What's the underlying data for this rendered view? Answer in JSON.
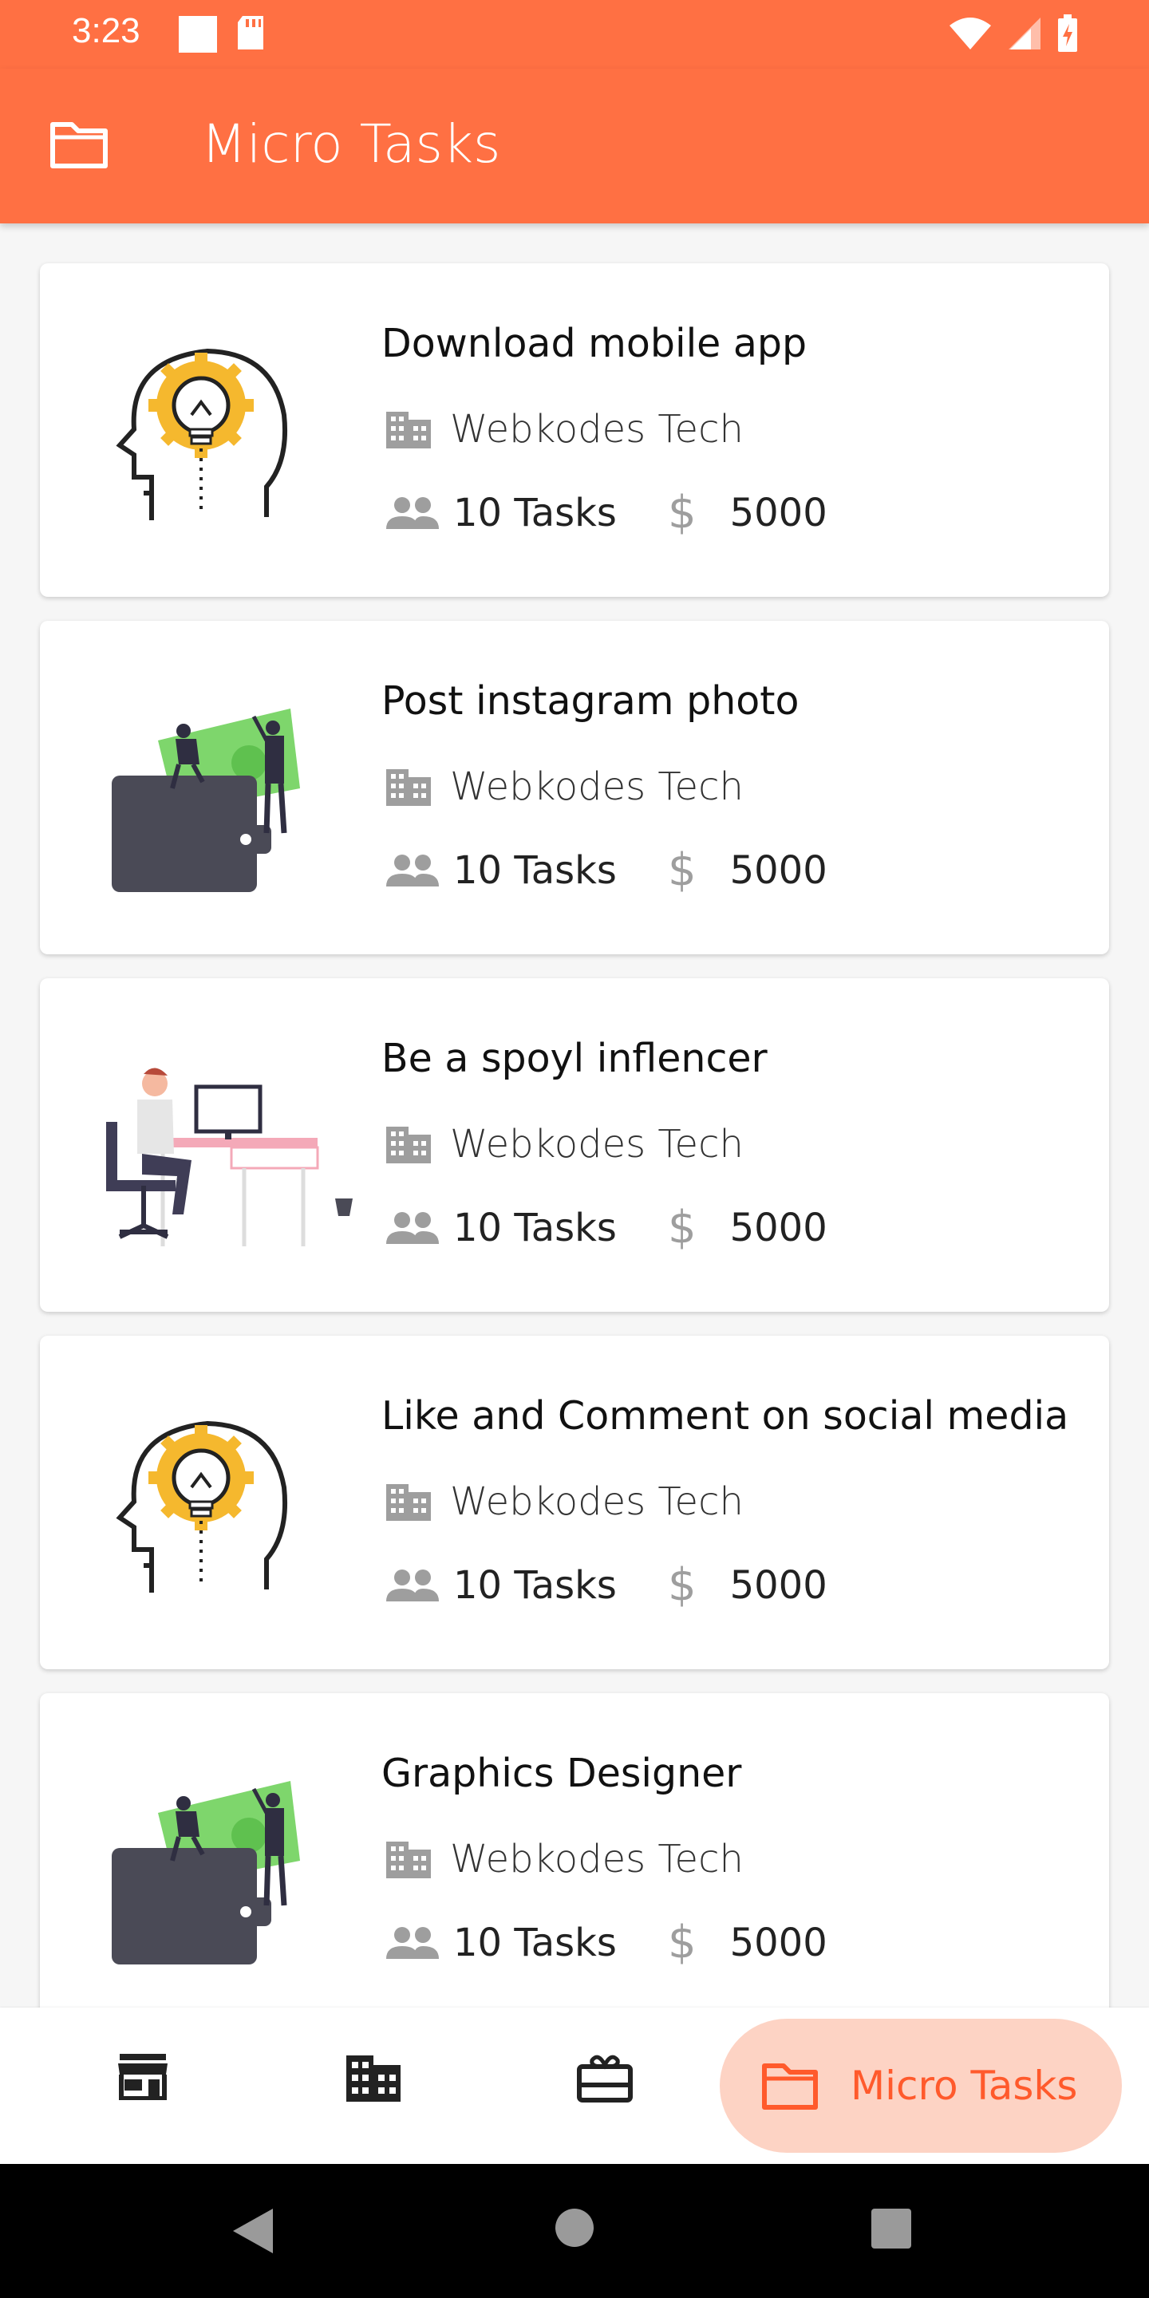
{
  "status_bar": {
    "time": "3:23"
  },
  "app_bar": {
    "title": "Micro Tasks"
  },
  "cards": [
    {
      "title": "Download mobile app",
      "company": "Webkodes Tech",
      "tasks": "10 Tasks",
      "amount": "5000",
      "illustration": "bulb-head"
    },
    {
      "title": "Post instagram photo",
      "company": "Webkodes Tech",
      "tasks": "10 Tasks",
      "amount": "5000",
      "illustration": "wallet-money"
    },
    {
      "title": "Be a spoyl inflencer",
      "company": "Webkodes Tech",
      "tasks": "10 Tasks",
      "amount": "5000",
      "illustration": "desk-worker"
    },
    {
      "title": "Like and Comment on social media",
      "company": "Webkodes Tech",
      "tasks": "10 Tasks",
      "amount": "5000",
      "illustration": "bulb-head"
    },
    {
      "title": "Graphics Designer",
      "company": "Webkodes Tech",
      "tasks": "10 Tasks",
      "amount": "5000",
      "illustration": "wallet-money"
    }
  ],
  "bottom_nav": {
    "items": [
      {
        "icon": "store-icon"
      },
      {
        "icon": "building-icon"
      },
      {
        "icon": "gift-icon"
      },
      {
        "icon": "folder-icon",
        "label": "Micro Tasks",
        "active": true
      }
    ]
  },
  "colors": {
    "accent": "#ff7043",
    "active_pill": "#fdd3c4",
    "active_text": "#ff5a2c"
  }
}
